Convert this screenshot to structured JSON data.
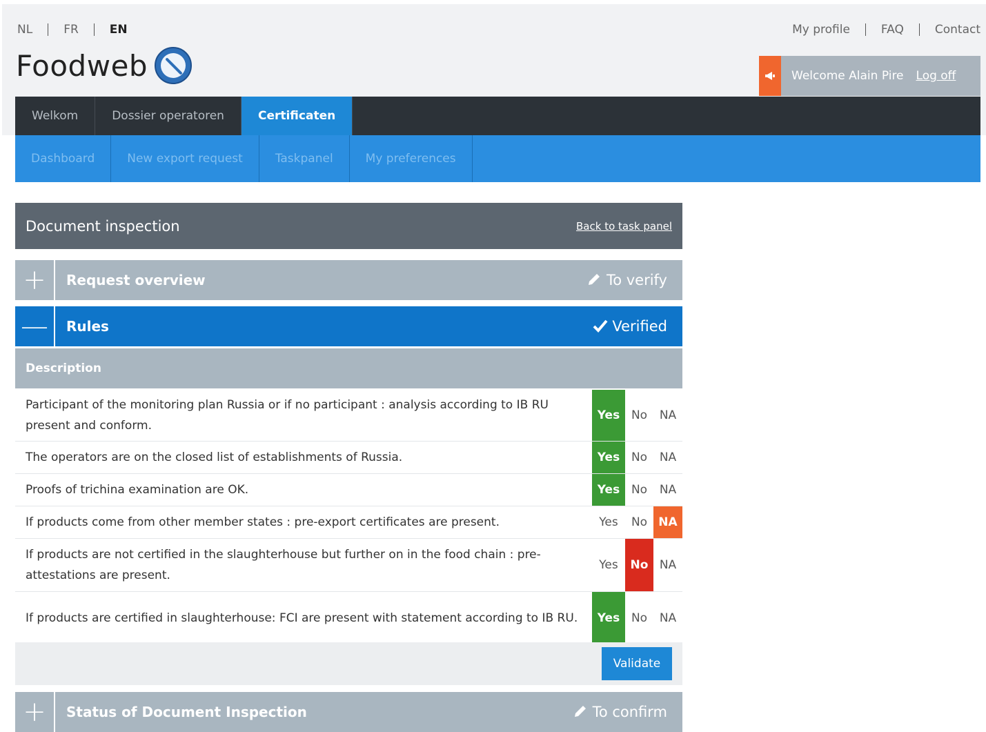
{
  "languages": [
    {
      "code": "NL",
      "active": false
    },
    {
      "code": "FR",
      "active": false
    },
    {
      "code": "EN",
      "active": true
    }
  ],
  "top_links": [
    "My profile",
    "FAQ",
    "Contact"
  ],
  "logo_text": "Foodweb",
  "user": {
    "welcome": "Welcome Alain Pire",
    "logoff": "Log off"
  },
  "main_nav": [
    {
      "label": "Welkom",
      "active": false
    },
    {
      "label": "Dossier operatoren",
      "active": false
    },
    {
      "label": "Certificaten",
      "active": true
    }
  ],
  "sub_nav": [
    "Dashboard",
    "New export request",
    "Taskpanel",
    "My preferences"
  ],
  "doc": {
    "title": "Document inspection",
    "back_link": "Back to task panel"
  },
  "sections": {
    "request": {
      "title": "Request overview",
      "status": "To verify",
      "icon": "pencil-icon",
      "toggle": "+"
    },
    "rules": {
      "title": "Rules",
      "status": "Verified",
      "icon": "check-icon",
      "toggle": "—"
    },
    "status": {
      "title": "Status of Document Inspection",
      "status": "To confirm",
      "icon": "pencil-icon",
      "toggle": "+"
    }
  },
  "rules_table": {
    "header": "Description",
    "options": [
      "Yes",
      "No",
      "NA"
    ],
    "rows": [
      {
        "text": "Participant of the monitoring plan Russia or if no participant : analysis according to IB RU present and conform.",
        "selected": "Yes",
        "height": 74
      },
      {
        "text": "The operators are on the closed list of establishments of Russia.",
        "selected": "Yes",
        "height": 46
      },
      {
        "text": "Proofs of trichina examination are OK.",
        "selected": "Yes",
        "height": 46
      },
      {
        "text": "If products come from other member states : pre-export certificates are present.",
        "selected": "NA",
        "height": 46
      },
      {
        "text": "If products are not certified in the slaughterhouse but further on in the food chain : pre-attestations are present.",
        "selected": "No",
        "height": 76
      },
      {
        "text": "If products are certified in slaughterhouse: FCI are present with statement according to IB RU.",
        "selected": "Yes",
        "height": 76
      }
    ]
  },
  "validate_label": "Validate",
  "colors": {
    "yes": "#3b9a35",
    "no": "#d92b1e",
    "na": "#f0662e",
    "primary": "#1e88d6"
  }
}
